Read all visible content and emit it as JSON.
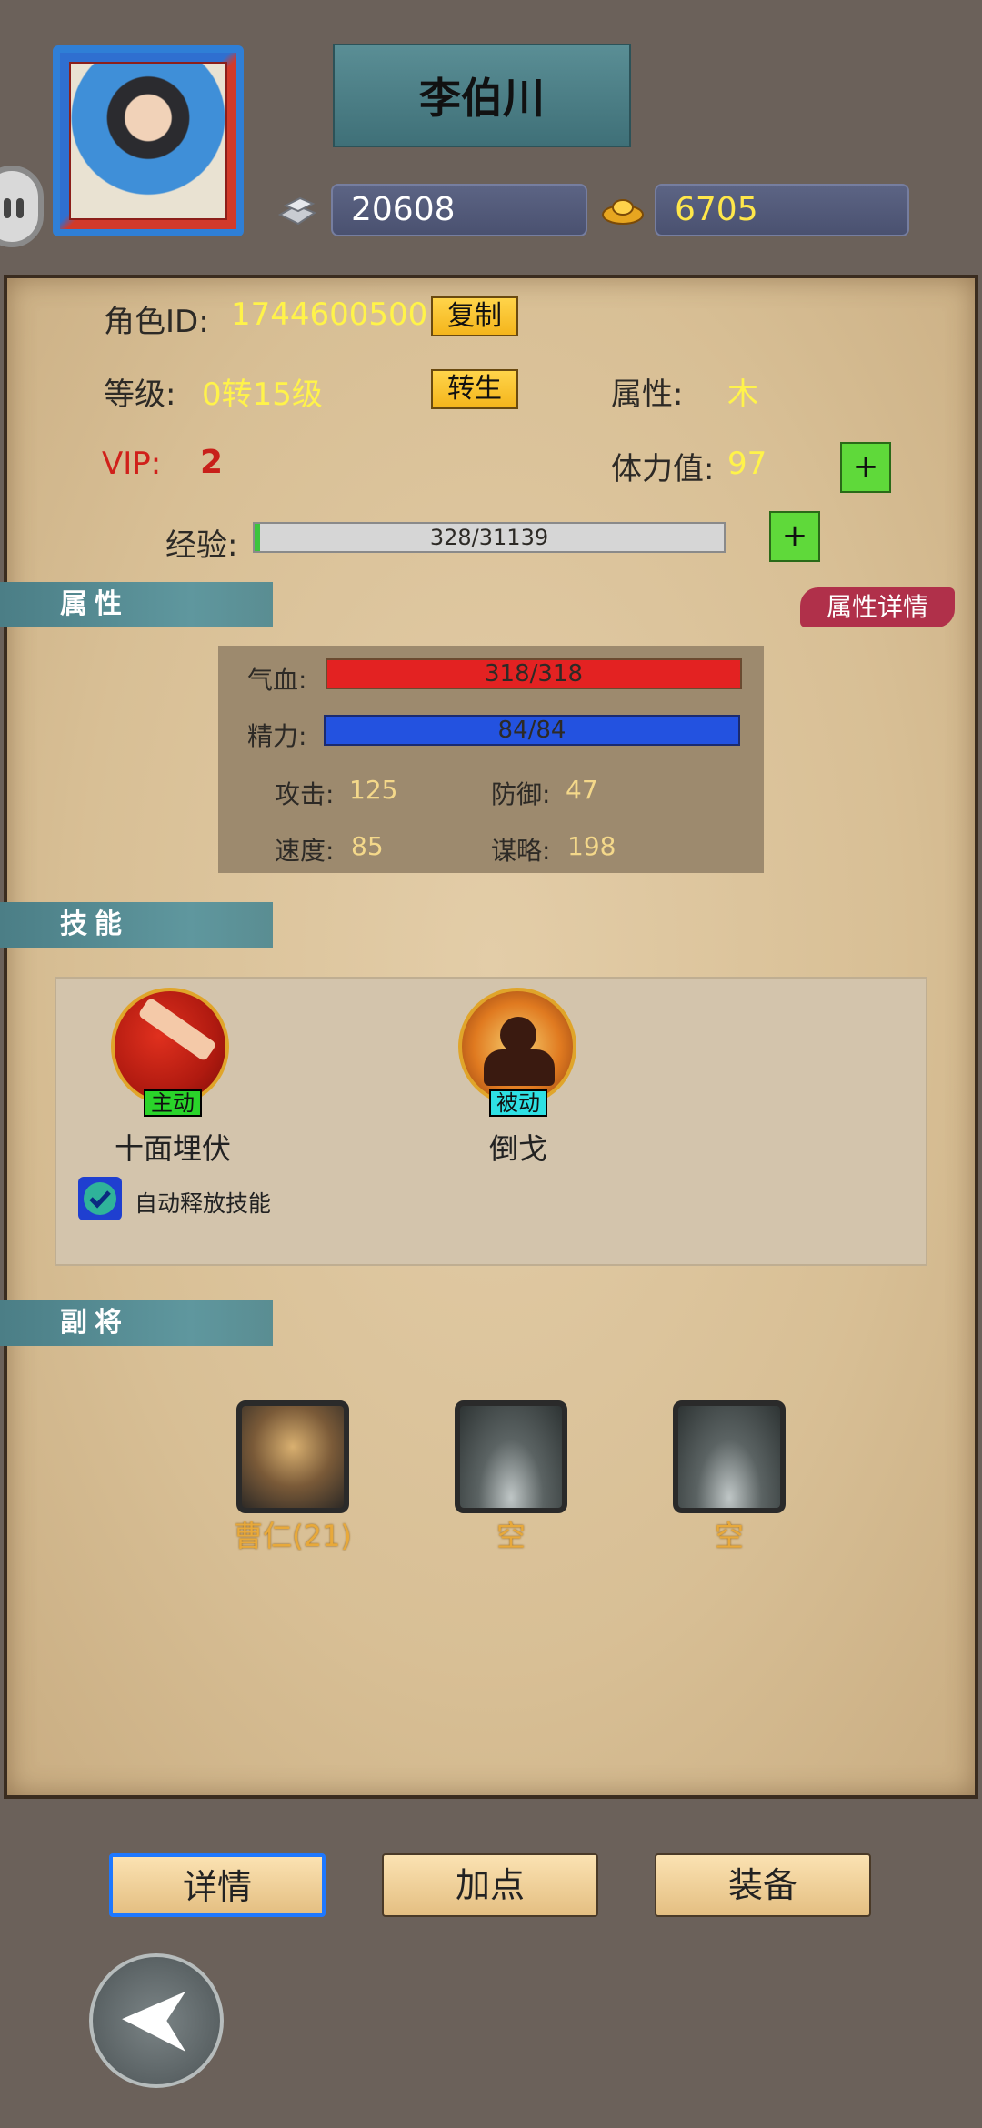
{
  "header": {
    "player_name": "李伯川",
    "silver": "20608",
    "gold": "6705"
  },
  "profile": {
    "id_label": "角色ID:",
    "id_value": "1744600500",
    "copy_btn": "复制",
    "level_label": "等级:",
    "level_value": "0转15级",
    "rebirth_btn": "转生",
    "element_label": "属性:",
    "element_value": "木",
    "vip_label": "VIP:",
    "vip_value": "2",
    "stamina_label": "体力值:",
    "stamina_value": "97",
    "exp_label": "经验:",
    "exp_text": "328/31139",
    "exp_ratio": 0.0105,
    "plus": "+"
  },
  "attributes": {
    "header": "属性",
    "detail_btn": "属性详情",
    "hp_label": "气血:",
    "hp_text": "318/318",
    "mp_label": "精力:",
    "mp_text": "84/84",
    "atk_label": "攻击:",
    "atk_value": "125",
    "def_label": "防御:",
    "def_value": "47",
    "spd_label": "速度:",
    "spd_value": "85",
    "stg_label": "谋略:",
    "stg_value": "198"
  },
  "skills": {
    "header": "技能",
    "items": [
      {
        "tag": "主动",
        "name": "十面埋伏"
      },
      {
        "tag": "被动",
        "name": "倒戈"
      }
    ],
    "auto_cast_label": "自动释放技能",
    "auto_cast_checked": true
  },
  "deputies": {
    "header": "副将",
    "slots": [
      {
        "name": "曹仁(21)"
      },
      {
        "name": "空"
      },
      {
        "name": "空"
      }
    ]
  },
  "tabs": {
    "details": "详情",
    "add_points": "加点",
    "equipment": "装备"
  },
  "colors": {
    "hp_bar": "#e32222",
    "mp_bar": "#2352e0",
    "value_yellow": "#fff34a",
    "vip_red": "#d0201a"
  }
}
